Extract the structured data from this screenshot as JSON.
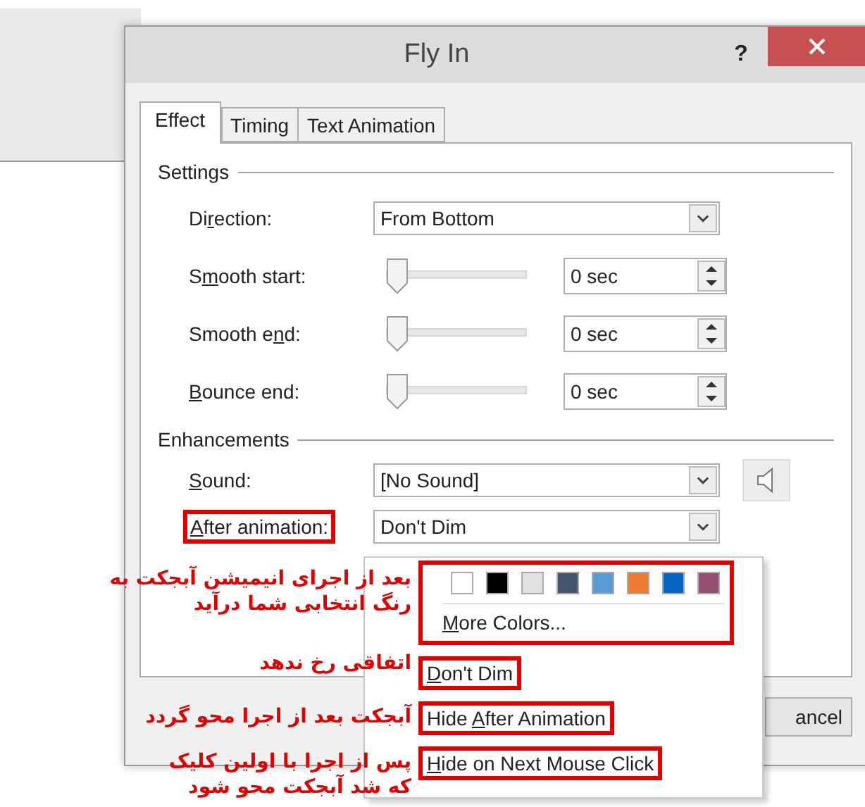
{
  "window": {
    "title": "Fly In",
    "help": "?"
  },
  "tabs": [
    {
      "label": "Effect",
      "selected": true
    },
    {
      "label": "Timing",
      "selected": false
    },
    {
      "label": "Text Animation",
      "selected": false
    }
  ],
  "settings": {
    "heading": "Settings",
    "direction": {
      "label": {
        "pre": "Di",
        "key": "r",
        "post": "ection:"
      },
      "value": "From Bottom"
    },
    "sliders": [
      {
        "label": {
          "pre": "S",
          "key": "m",
          "post": "ooth start:"
        },
        "level": 0,
        "value": "0 sec"
      },
      {
        "label": {
          "pre": "Smooth e",
          "key": "n",
          "post": "d:"
        },
        "level": 0,
        "value": "0 sec"
      },
      {
        "label": {
          "key": "B",
          "post": "ounce end:"
        },
        "level": 0,
        "value": "0 sec"
      }
    ]
  },
  "enhancements": {
    "heading": "Enhancements",
    "sound": {
      "label": {
        "key": "S",
        "post": "ound:"
      },
      "value": "[No Sound]"
    },
    "after_animation": {
      "label": {
        "key": "A",
        "post": "fter animation:"
      },
      "value": "Don't Dim",
      "highlighted": true
    }
  },
  "buttons": [
    {
      "label": "ancel"
    }
  ],
  "menu": {
    "swatches_highlighted": true,
    "swatches": [
      {
        "color": "#ffffff"
      },
      {
        "color": "#000000"
      },
      {
        "color": "#e0e0e0"
      },
      {
        "color": "#44546a"
      },
      {
        "color": "#5b9bd5"
      },
      {
        "color": "#ed7d31"
      },
      {
        "color": "#0563c1"
      },
      {
        "color": "#954f72"
      }
    ],
    "more_colors": {
      "label": {
        "key": "M",
        "post": "ore Colors..."
      }
    },
    "items": [
      {
        "label": {
          "key": "D",
          "post": "on't Dim"
        },
        "highlighted": true
      },
      {
        "label": {
          "pre": "Hide ",
          "key": "A",
          "post": "fter Animation"
        },
        "highlighted": true
      },
      {
        "label": {
          "key": "H",
          "post": "ide on Next Mouse Click"
        },
        "highlighted": true
      }
    ]
  },
  "annotations": [
    {
      "text": "بعد از اجرای انیمیشن آبجکت به\nرنگ انتخابی شما درآید"
    },
    {
      "text": "اتفاقی رخ ندهد"
    },
    {
      "text": "آبجکت بعد از اجرا محو گردد"
    },
    {
      "text": "پس از اجرا با اولین کلیک\nکه شد آبجکت محو شود"
    }
  ]
}
